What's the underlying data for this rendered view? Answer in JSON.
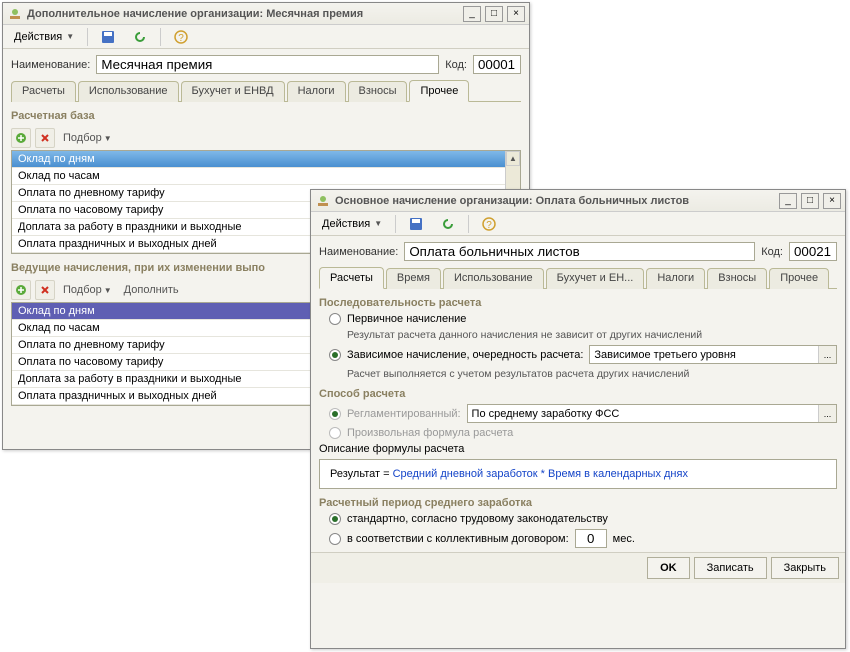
{
  "win1": {
    "title": "Дополнительное начисление организации: Месячная премия",
    "actions": "Действия",
    "name_label": "Наименование:",
    "name_value": "Месячная премия",
    "code_label": "Код:",
    "code_value": "00001",
    "tabs": [
      "Расчеты",
      "Использование",
      "Бухучет и ЕНВД",
      "Налоги",
      "Взносы",
      "Прочее"
    ],
    "active_tab_index": 5,
    "group1": "Расчетная база",
    "pick_label": "Подбор",
    "list1": [
      "Оклад по дням",
      "Оклад по часам",
      "Оплата по дневному тарифу",
      "Оплата по часовому тарифу",
      "Доплата за работу в праздники и выходные",
      "Оплата праздничных и выходных дней"
    ],
    "group2": "Ведущие начисления, при их изменении выпо",
    "addl_label": "Дополнить",
    "list2": [
      "Оклад по дням",
      "Оклад по часам",
      "Оплата по дневному тарифу",
      "Оплата по часовому тарифу",
      "Доплата за работу в праздники и выходные",
      "Оплата праздничных и выходных дней"
    ]
  },
  "win2": {
    "title": "Основное начисление организации: Оплата больничных листов",
    "actions": "Действия",
    "name_label": "Наименование:",
    "name_value": "Оплата больничных листов",
    "code_label": "Код:",
    "code_value": "00021",
    "tabs": [
      "Расчеты",
      "Время",
      "Использование",
      "Бухучет и ЕН...",
      "Налоги",
      "Взносы",
      "Прочее"
    ],
    "active_tab_index": 0,
    "seq_hdr": "Последовательность расчета",
    "radio_primary": "Первичное начисление",
    "hint_primary": "Результат расчета данного начисления не зависит от других начислений",
    "radio_dep": "Зависимое начисление, очередность расчета:",
    "dep_value": "Зависимое третьего уровня",
    "hint_dep": "Расчет выполняется с учетом результатов расчета других начислений",
    "method_hdr": "Способ расчета",
    "radio_reg": "Регламентированный:",
    "reg_value": "По среднему заработку ФСС",
    "radio_free": "Произвольная формула расчета",
    "formula_hdr": "Описание формулы расчета",
    "formula_prefix": "Результат = ",
    "formula_expr": "Средний дневной заработок * Время в календарных днях",
    "period_hdr": "Расчетный период среднего заработка",
    "radio_std": "стандартно, согласно трудовому законодательству",
    "radio_col": "в соответствии с коллективным договором:",
    "period_value": "0",
    "period_unit": "мес.",
    "ok": "OK",
    "save": "Записать",
    "close": "Закрыть"
  }
}
